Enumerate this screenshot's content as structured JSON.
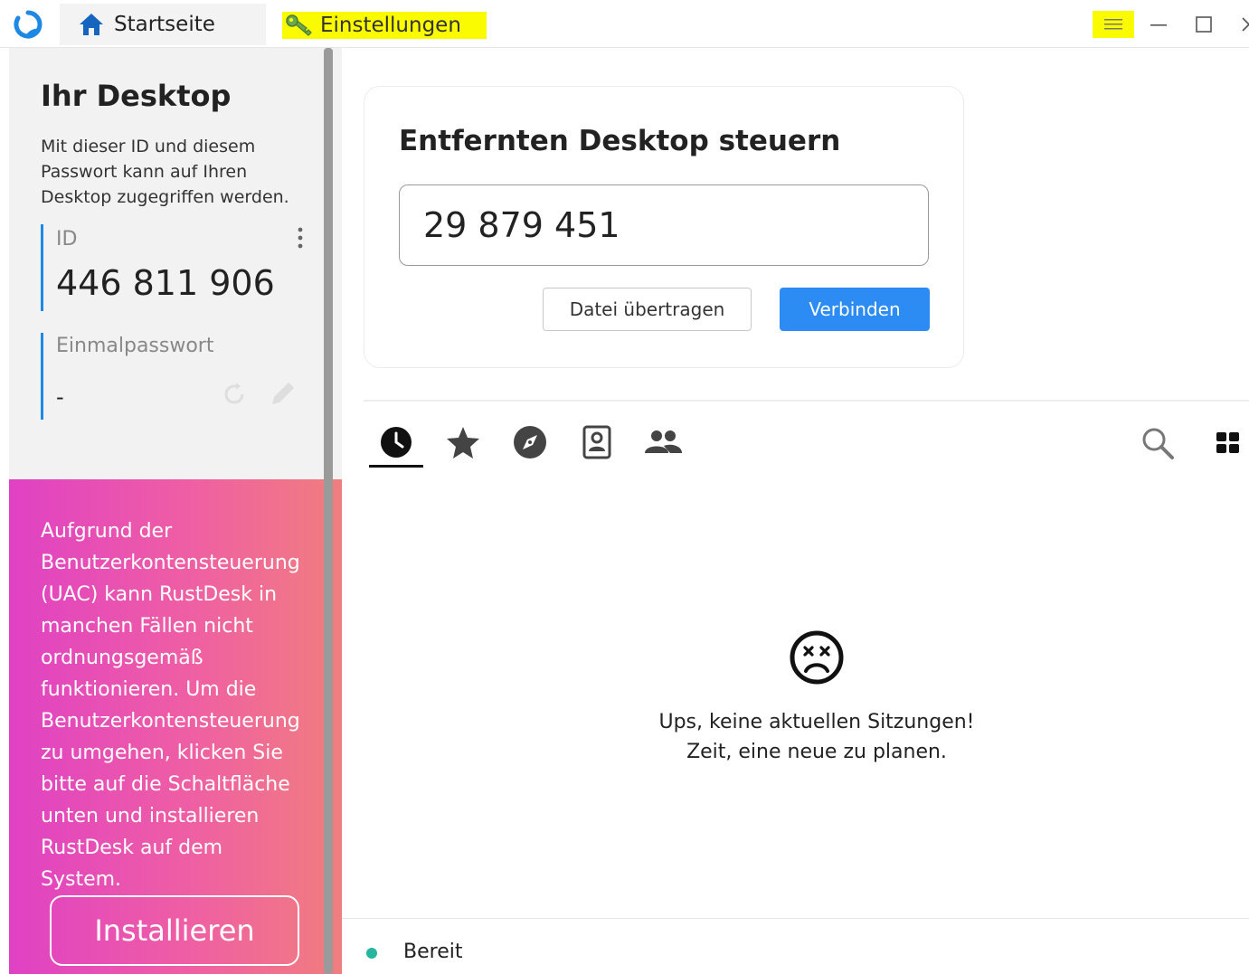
{
  "titlebar": {
    "home_tab_label": "Startseite",
    "settings_tab_label": "Einstellungen",
    "highlight_color": "#fbfb00"
  },
  "sidebar": {
    "title": "Ihr Desktop",
    "description": "Mit dieser ID und diesem Passwort kann auf Ihren Desktop zugegriffen werden.",
    "id_label": "ID",
    "id_value": "446 811 906",
    "password_label": "Einmalpasswort",
    "password_value": "-",
    "accent_color": "#1e88e5",
    "uac_text": "Aufgrund der Benutzerkontensteuerung (UAC) kann RustDesk in manchen Fällen nicht ordnungsgemäß funktionieren. Um die Benutzerkontensteuerung zu umgehen, klicken Sie bitte auf die Schaltfläche unten und installieren RustDesk auf dem System.",
    "install_label": "Installieren"
  },
  "connect": {
    "title": "Entfernten Desktop steuern",
    "remote_id_value": "29 879 451",
    "transfer_label": "Datei übertragen",
    "connect_label": "Verbinden",
    "connect_color": "#2c8cf4"
  },
  "peers": {
    "tabs": [
      "recent-sessions",
      "favorites",
      "discovered",
      "address-book",
      "group"
    ],
    "active_tab": "recent-sessions",
    "empty_line1": "Ups, keine aktuellen Sitzungen!",
    "empty_line2": "Zeit, eine neue zu planen."
  },
  "status": {
    "text": "Bereit",
    "dot_color": "#26b59f"
  }
}
